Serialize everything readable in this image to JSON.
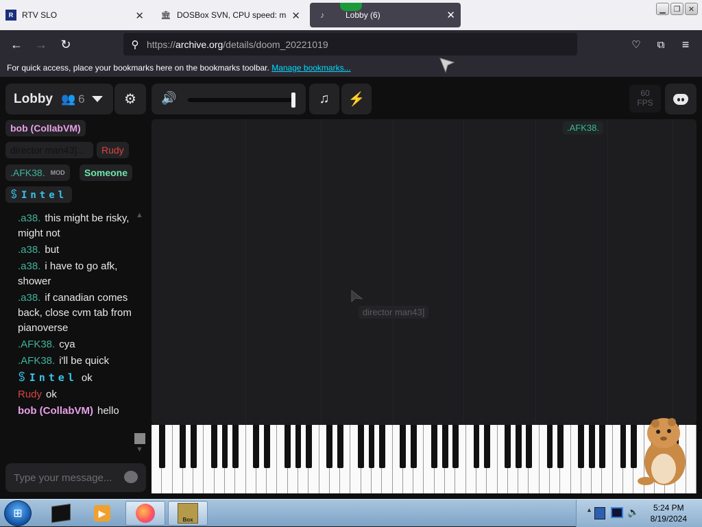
{
  "browser": {
    "tabs": [
      {
        "label": "RTV SLO",
        "icon": "rtv-favicon"
      },
      {
        "label": "DOSBox SVN, CPU speed: max",
        "icon": "archive-favicon"
      },
      {
        "label": "Lobby (6)",
        "icon": "pianoverse-favicon"
      }
    ],
    "url_prefix": "https://",
    "url_domain": "archive.org",
    "url_path": "/details/doom_20221019",
    "bookmarks_text": "For quick access, place your bookmarks here on the bookmarks toolbar.",
    "bookmarks_link": "Manage bookmarks..."
  },
  "lobby": {
    "title": "Lobby",
    "user_count": "6",
    "users": [
      {
        "name": "bob (CollabVM)",
        "color": "#e8a0e8"
      },
      {
        "name": "director man43]...",
        "color": "#111111"
      },
      {
        "name": "Rudy",
        "color": "#d9443f"
      },
      {
        "name": ".AFK38.",
        "color": "#3fb39a",
        "badge": "MOD"
      },
      {
        "name": "Someone",
        "color": "#6ee7a8"
      },
      {
        "name": "ꌗIntel",
        "color": "#37c5e8"
      }
    ]
  },
  "chat": {
    "messages": [
      {
        "who": ".a38.",
        "text": "this might be risky, might not",
        "color": "#3fb39a"
      },
      {
        "who": ".a38.",
        "text": "but",
        "color": "#3fb39a"
      },
      {
        "who": ".a38.",
        "text": "i have to go afk, shower",
        "color": "#3fb39a"
      },
      {
        "who": ".a38.",
        "text": "if canadian comes back, close cvm tab from pianoverse",
        "color": "#3fb39a"
      },
      {
        "who": ".AFK38.",
        "text": "cya",
        "color": "#3fb39a"
      },
      {
        "who": ".AFK38.",
        "text": "i'll be quick",
        "color": "#3fb39a"
      },
      {
        "who": "ꌗIntel",
        "text": "ok",
        "color": "#37c5e8"
      },
      {
        "who": "Rudy",
        "text": "ok",
        "color": "#d9443f"
      },
      {
        "who": "bob (CollabVM)",
        "text": "hello",
        "color": "#e8a0e8"
      }
    ],
    "input_placeholder": "Type your message..."
  },
  "controls": {
    "volume_level": 0.98,
    "fps_value": "60",
    "fps_unit": "FPS"
  },
  "stage": {
    "cursors": [
      {
        "label": ".AFK38.",
        "color": "#3fb39a"
      },
      {
        "label": "director man43]",
        "color": "#5a5a5f"
      }
    ]
  },
  "taskbar": {
    "time": "5:24 PM",
    "date": "8/19/2024"
  }
}
